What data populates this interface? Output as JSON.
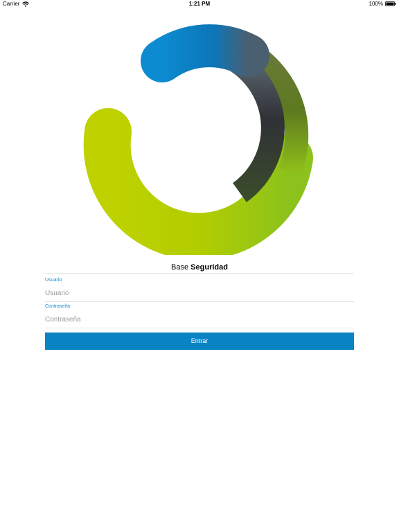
{
  "status_bar": {
    "carrier": "Carrier",
    "time": "1:21 PM",
    "battery": "100%"
  },
  "icons": {
    "wifi": "wifi-icon",
    "battery": "battery-icon",
    "logo": "ring-logo"
  },
  "colors": {
    "accent": "#0a83c4",
    "label": "#1a88c9",
    "logo_blue": "#0c7fc4",
    "logo_green": "#b7cf00",
    "logo_dark": "#2e3034"
  },
  "title": {
    "regular": "Base",
    "bold": "Seguridad"
  },
  "form": {
    "username": {
      "label": "Usuario",
      "placeholder": "Usuario",
      "value": ""
    },
    "password": {
      "label": "Contraseña",
      "placeholder": "Contraseña",
      "value": ""
    },
    "submit_label": "Entrar"
  }
}
